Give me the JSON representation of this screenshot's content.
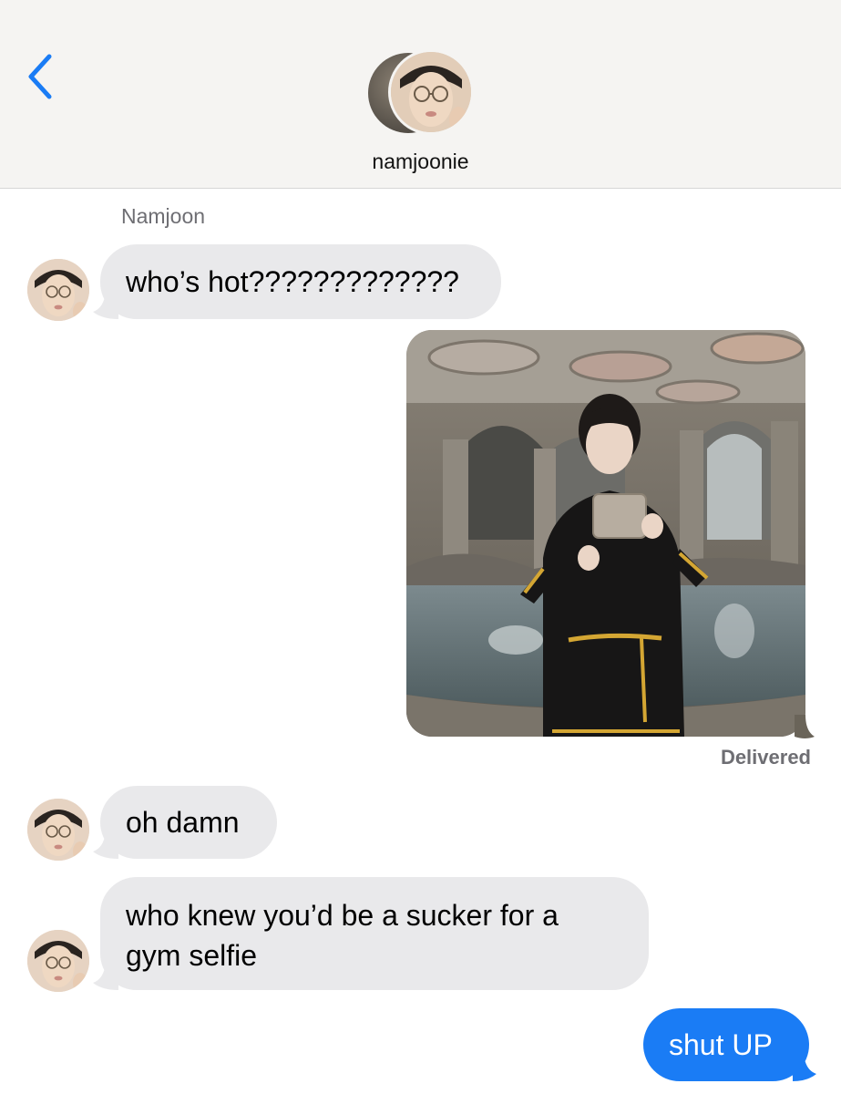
{
  "header": {
    "contact_name": "namjoonie"
  },
  "thread": {
    "sender_label": "Namjoon",
    "messages": [
      {
        "from": "them",
        "text": "who’s hot?????????????"
      },
      {
        "from": "me",
        "type": "photo"
      },
      {
        "from": "them",
        "text": "oh damn"
      },
      {
        "from": "them",
        "text": "who knew you’d be a sucker for a gym selfie"
      },
      {
        "from": "me",
        "text": "shut UP"
      }
    ],
    "status": "Delivered"
  },
  "colors": {
    "incoming_bubble": "#e9e9eb",
    "outgoing_bubble": "#1a7cf5",
    "back_chevron": "#1a7cf5",
    "header_bg": "#f5f4f2"
  }
}
